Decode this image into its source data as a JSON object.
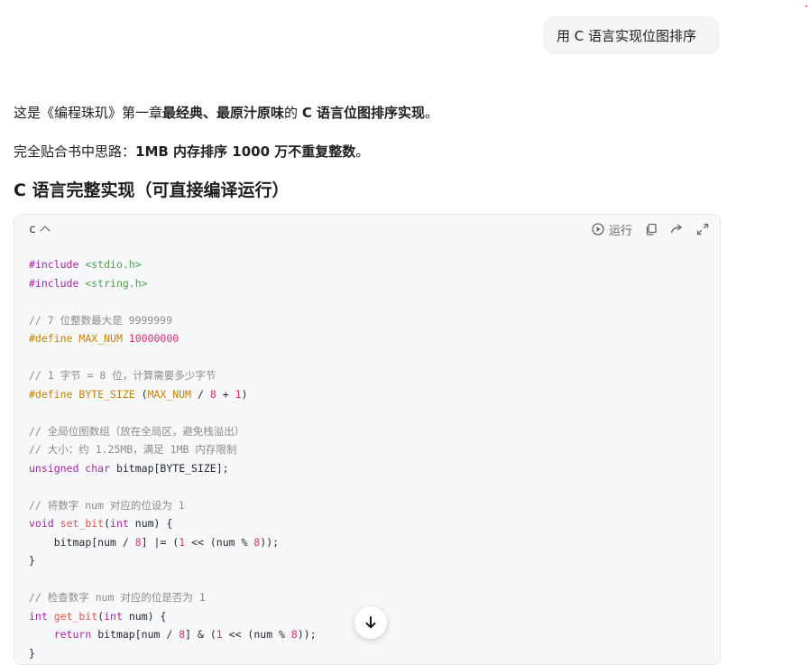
{
  "user_message": "用 C 语言实现位图排序",
  "answer": {
    "p1": {
      "text_a": "这是《编程珠玑》第一章",
      "bold_a": "最经典、最原汁原味",
      "text_b": "的 ",
      "bold_b": "C 语言位图排序实现",
      "text_c": "。"
    },
    "p2": {
      "text_a": "完全贴合书中思路：",
      "bold_a": "1MB 内存排序 1000 万不重复整数",
      "text_b": "。"
    },
    "heading": "C 语言完整实现（可直接编译运行）"
  },
  "code_block": {
    "language": "c",
    "run_label": "运行",
    "lines": {
      "l1_kw": "#include",
      "l1_str": "<stdio.h>",
      "l2_kw": "#include",
      "l2_str": "<string.h>",
      "l4": "// 7 位整数最大是 9999999",
      "l5_kw": "#define",
      "l5_mac": "MAX_NUM",
      "l5_num": "10000000",
      "l7": "// 1 字节 = 8 位，计算需要多少字节",
      "l8_kw": "#define",
      "l8_mac": "BYTE_SIZE",
      "l8_a": "(",
      "l8_mac2": "MAX_NUM",
      "l8_b": "/",
      "l8_n1": "8",
      "l8_c": "+",
      "l8_n2": "1",
      "l8_d": ")",
      "l10": "// 全局位图数组（放在全局区，避免栈溢出）",
      "l11": "// 大小：约 1.25MB，满足 1MB 内存限制",
      "l12_kw": "unsigned char",
      "l12_rest": "bitmap[BYTE_SIZE];",
      "l14": "// 将数字 num 对应的位设为 1",
      "l15_kw": "void",
      "l15_fn": "set_bit",
      "l15_a": "(",
      "l15_kw2": "int",
      "l15_b": "num) {",
      "l16_a": "bitmap[num /",
      "l16_n1": "8",
      "l16_b": "] |= (",
      "l16_n2": "1",
      "l16_c": "<< (num %",
      "l16_n3": "8",
      "l16_d": "));",
      "l17": "}",
      "l19": "// 检查数字 num 对应的位是否为 1",
      "l20_kw": "int",
      "l20_fn": "get_bit",
      "l20_a": "(",
      "l20_kw2": "int",
      "l20_b": "num) {",
      "l21_kw": "return",
      "l21_a": "bitmap[num /",
      "l21_n1": "8",
      "l21_b": "] & (",
      "l21_n2": "1",
      "l21_c": "<< (num %",
      "l21_n3": "8",
      "l21_d": "));",
      "l22": "}"
    }
  },
  "icons": {
    "run": "play-circle-icon",
    "copy": "copy-icon",
    "share": "share-icon",
    "expand": "expand-icon",
    "scroll": "arrow-down-icon"
  }
}
